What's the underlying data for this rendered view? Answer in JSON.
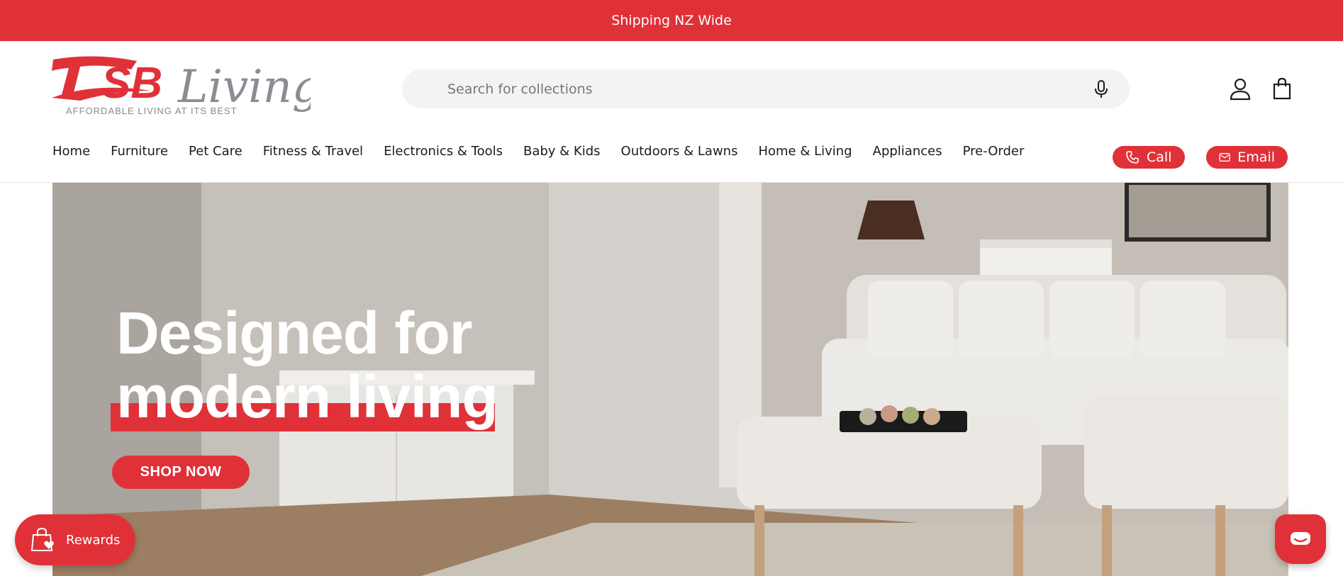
{
  "announcement": {
    "text": "Shipping NZ Wide"
  },
  "brand": {
    "name_primary": "TSB",
    "name_secondary": "Living",
    "tagline": "AFFORDABLE LIVING AT ITS BEST",
    "accent_color": "#e03138",
    "secondary_color": "#8a8d93"
  },
  "search": {
    "placeholder": "Search for collections",
    "value": "",
    "icon": "microphone-icon"
  },
  "header_icons": {
    "account": "account-icon",
    "cart": "shopping-bag-icon"
  },
  "nav": {
    "items": [
      {
        "label": "Home"
      },
      {
        "label": "Furniture"
      },
      {
        "label": "Pet Care"
      },
      {
        "label": "Fitness & Travel"
      },
      {
        "label": "Electronics & Tools"
      },
      {
        "label": "Baby & Kids"
      },
      {
        "label": "Outdoors & Lawns"
      },
      {
        "label": "Home & Living"
      },
      {
        "label": "Appliances"
      },
      {
        "label": "Pre-Order"
      }
    ]
  },
  "contact": {
    "call_label": "Call",
    "call_icon": "phone-icon",
    "email_label": "Email",
    "email_icon": "envelope-icon"
  },
  "hero": {
    "title_line1": "Designed for",
    "title_line2": "modern living",
    "cta_label": "SHOP NOW"
  },
  "rewards": {
    "label": "Rewards",
    "icon": "shopping-bag-heart-icon"
  },
  "chat": {
    "icon": "chat-bubble-icon"
  }
}
